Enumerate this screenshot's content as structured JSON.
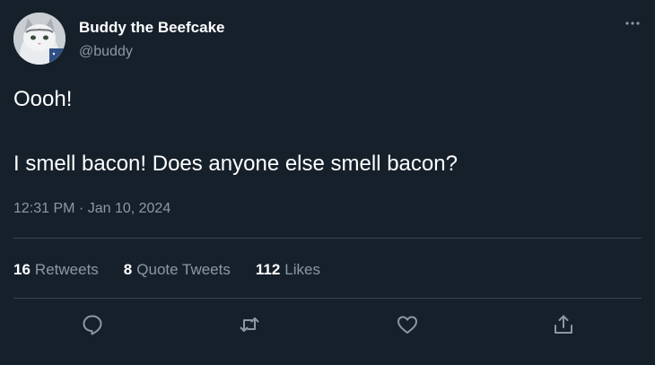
{
  "author": {
    "name": "Buddy the Beefcake",
    "handle": "@buddy",
    "avatar_icon": "cat-avatar"
  },
  "tweet": {
    "lines": [
      "Oooh!",
      "",
      "I smell bacon! Does anyone else smell bacon?"
    ],
    "timestamp": "12:31 PM · Jan 10, 2024"
  },
  "stats": {
    "retweets": {
      "count": "16",
      "label": "Retweets"
    },
    "quotes": {
      "count": "8",
      "label": "Quote Tweets"
    },
    "likes": {
      "count": "112",
      "label": "Likes"
    }
  },
  "actions": {
    "reply_icon": "reply-icon",
    "retweet_icon": "retweet-icon",
    "like_icon": "heart-icon",
    "share_icon": "share-icon",
    "more_icon": "more-icon"
  },
  "colors": {
    "background": "#15202b",
    "text": "#ffffff",
    "secondary_text": "#8b98a5",
    "divider": "#38444d"
  }
}
